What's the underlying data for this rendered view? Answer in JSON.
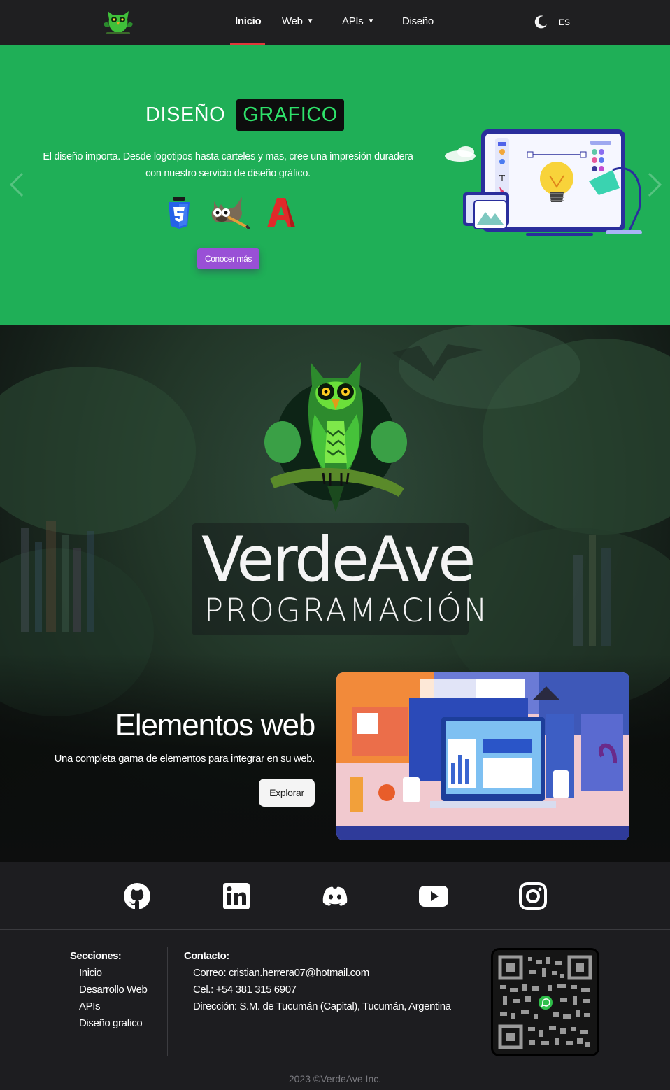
{
  "nav": {
    "logo_icon": "owl-logo-icon",
    "links": [
      {
        "label": "Inicio",
        "active": true
      },
      {
        "label": "Web",
        "dropdown": true
      },
      {
        "label": "APIs",
        "dropdown": true
      },
      {
        "label": "Diseño"
      }
    ],
    "theme_icon": "moon-icon",
    "language": "ES"
  },
  "hero": {
    "title_part1": "DISEÑO",
    "title_part2": "GRAFICO",
    "description_line1": "El diseño importa. Desde logotipos hasta carteles y mas, cree una impresión duradera",
    "description_line2": "con nuestro servicio de diseño gráfico.",
    "tool_icons": [
      "css3-icon",
      "gimp-icon",
      "adobe-icon"
    ],
    "button_label": "Conocer más",
    "background_color": "#1faf57",
    "button_color": "#9950d6"
  },
  "banner": {
    "brand_name": "VerdeAve",
    "brand_sub": "PROGRAMACIÓN",
    "section_title": "Elementos web",
    "section_desc": "Una completa gama de elementos para integrar en su web.",
    "button_label": "Explorar"
  },
  "social": [
    "github-icon",
    "linkedin-icon",
    "discord-icon",
    "youtube-icon",
    "instagram-icon"
  ],
  "footer": {
    "sections_title": "Secciones:",
    "sections": [
      "Inicio",
      "Desarrollo Web",
      "APIs",
      "Diseño grafico"
    ],
    "contact_title": "Contacto:",
    "email": "Correo: cristian.herrera07@hotmail.com",
    "phone": "Cel.: +54 381 315 6907",
    "address": "Dirección: S.M. de Tucumán (Capital), Tucumán, Argentina",
    "qr_icon": "whatsapp-qr-code",
    "copyright": "2023 ©VerdeAve Inc."
  }
}
